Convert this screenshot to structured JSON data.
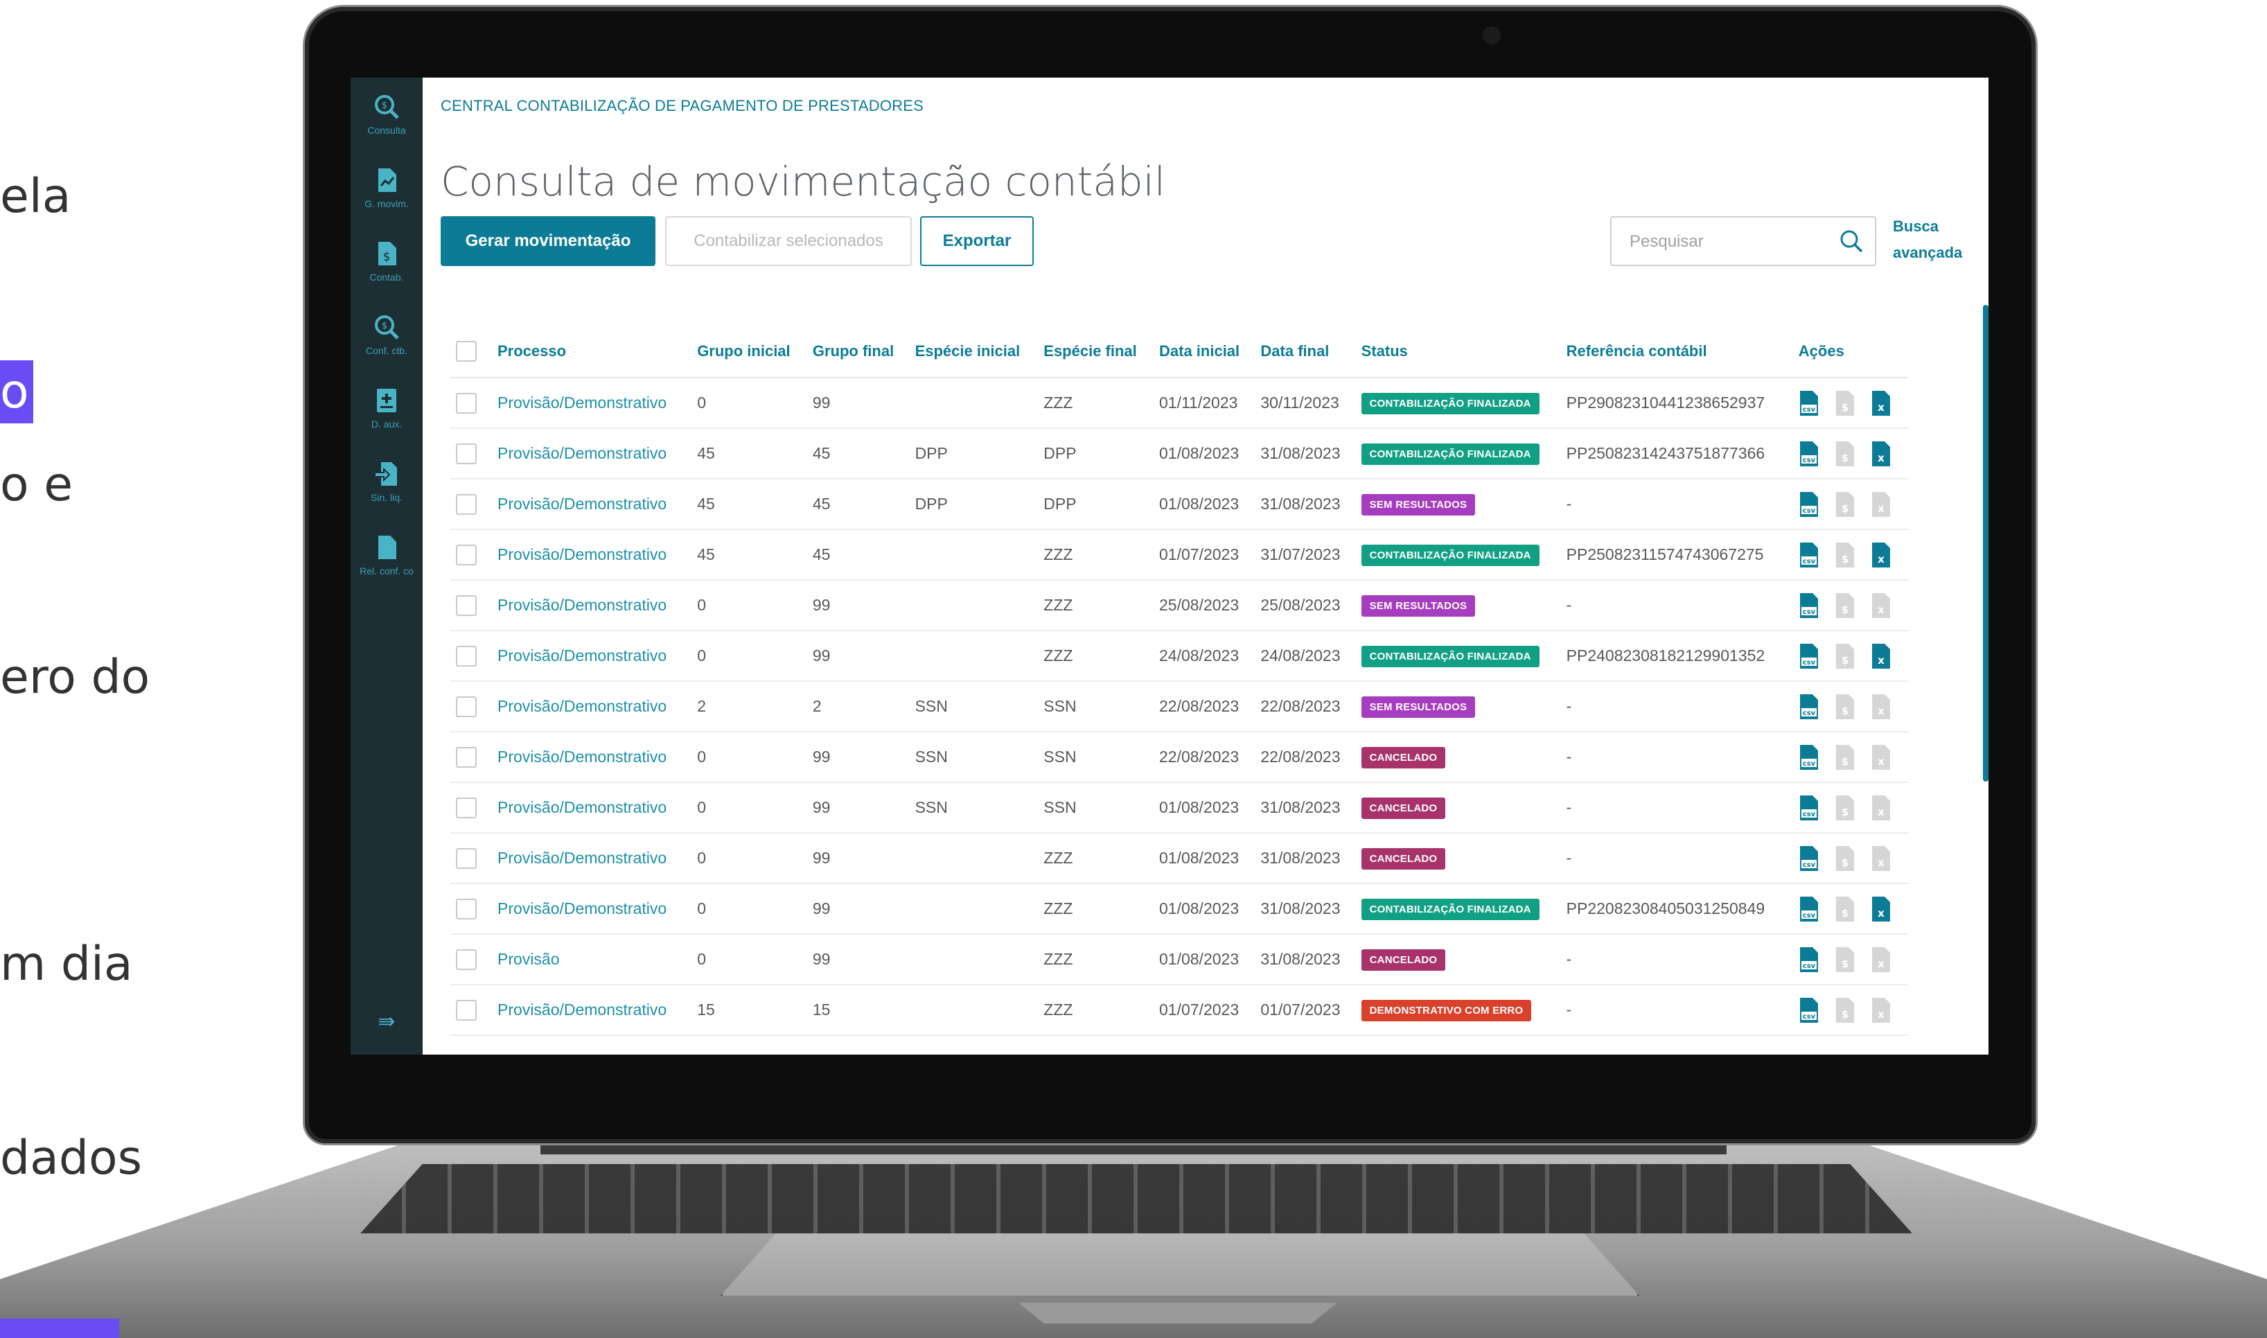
{
  "slide_fragments": [
    {
      "text": "ela"
    },
    {
      "text": "o",
      "highlight": true
    },
    {
      "text": "o e"
    },
    {
      "text": "ero do"
    },
    {
      "text": "m dia"
    },
    {
      "text": "dados"
    }
  ],
  "sidebar": {
    "items": [
      {
        "label": "Consulta",
        "icon": "search-money-icon"
      },
      {
        "label": "G. movim.",
        "icon": "file-chart-icon"
      },
      {
        "label": "Contab.",
        "icon": "file-money-icon"
      },
      {
        "label": "Conf. ctb.",
        "icon": "search-money-icon"
      },
      {
        "label": "D. aux.",
        "icon": "plus-box-icon"
      },
      {
        "label": "Sin. liq.",
        "icon": "file-import-icon"
      },
      {
        "label": "Rel. conf. co",
        "icon": "file-icon"
      }
    ],
    "collapse_icon": "⇛"
  },
  "header": {
    "breadcrumb": "CENTRAL CONTABILIZAÇÃO DE PAGAMENTO DE PRESTADORES",
    "title": "Consulta de movimentação contábil"
  },
  "toolbar": {
    "generate_label": "Gerar movimentação",
    "post_selected_label": "Contabilizar selecionados",
    "export_label": "Exportar",
    "search_placeholder": "Pesquisar",
    "advanced_search_label": "Busca avançada"
  },
  "table": {
    "columns": [
      "Processo",
      "Grupo inicial",
      "Grupo final",
      "Espécie inicial",
      "Espécie final",
      "Data inicial",
      "Data final",
      "Status",
      "Referência contábil",
      "Ações"
    ],
    "rows": [
      {
        "processo": "Provisão/Demonstrativo",
        "grupo_inicial": "0",
        "grupo_final": "99",
        "especie_inicial": "",
        "especie_final": "ZZZ",
        "data_inicial": "01/11/2023",
        "data_final": "30/11/2023",
        "status": "CONTABILIZAÇÃO FINALIZADA",
        "referencia": "PP29082310441238652937"
      },
      {
        "processo": "Provisão/Demonstrativo",
        "grupo_inicial": "45",
        "grupo_final": "45",
        "especie_inicial": "DPP",
        "especie_final": "DPP",
        "data_inicial": "01/08/2023",
        "data_final": "31/08/2023",
        "status": "CONTABILIZAÇÃO FINALIZADA",
        "referencia": "PP25082314243751877366"
      },
      {
        "processo": "Provisão/Demonstrativo",
        "grupo_inicial": "45",
        "grupo_final": "45",
        "especie_inicial": "DPP",
        "especie_final": "DPP",
        "data_inicial": "01/08/2023",
        "data_final": "31/08/2023",
        "status": "SEM RESULTADOS",
        "referencia": "-"
      },
      {
        "processo": "Provisão/Demonstrativo",
        "grupo_inicial": "45",
        "grupo_final": "45",
        "especie_inicial": "",
        "especie_final": "ZZZ",
        "data_inicial": "01/07/2023",
        "data_final": "31/07/2023",
        "status": "CONTABILIZAÇÃO FINALIZADA",
        "referencia": "PP25082311574743067275"
      },
      {
        "processo": "Provisão/Demonstrativo",
        "grupo_inicial": "0",
        "grupo_final": "99",
        "especie_inicial": "",
        "especie_final": "ZZZ",
        "data_inicial": "25/08/2023",
        "data_final": "25/08/2023",
        "status": "SEM RESULTADOS",
        "referencia": "-"
      },
      {
        "processo": "Provisão/Demonstrativo",
        "grupo_inicial": "0",
        "grupo_final": "99",
        "especie_inicial": "",
        "especie_final": "ZZZ",
        "data_inicial": "24/08/2023",
        "data_final": "24/08/2023",
        "status": "CONTABILIZAÇÃO FINALIZADA",
        "referencia": "PP24082308182129901352"
      },
      {
        "processo": "Provisão/Demonstrativo",
        "grupo_inicial": "2",
        "grupo_final": "2",
        "especie_inicial": "SSN",
        "especie_final": "SSN",
        "data_inicial": "22/08/2023",
        "data_final": "22/08/2023",
        "status": "SEM RESULTADOS",
        "referencia": "-"
      },
      {
        "processo": "Provisão/Demonstrativo",
        "grupo_inicial": "0",
        "grupo_final": "99",
        "especie_inicial": "SSN",
        "especie_final": "SSN",
        "data_inicial": "22/08/2023",
        "data_final": "22/08/2023",
        "status": "CANCELADO",
        "referencia": "-"
      },
      {
        "processo": "Provisão/Demonstrativo",
        "grupo_inicial": "0",
        "grupo_final": "99",
        "especie_inicial": "SSN",
        "especie_final": "SSN",
        "data_inicial": "01/08/2023",
        "data_final": "31/08/2023",
        "status": "CANCELADO",
        "referencia": "-"
      },
      {
        "processo": "Provisão/Demonstrativo",
        "grupo_inicial": "0",
        "grupo_final": "99",
        "especie_inicial": "",
        "especie_final": "ZZZ",
        "data_inicial": "01/08/2023",
        "data_final": "31/08/2023",
        "status": "CANCELADO",
        "referencia": "-"
      },
      {
        "processo": "Provisão/Demonstrativo",
        "grupo_inicial": "0",
        "grupo_final": "99",
        "especie_inicial": "",
        "especie_final": "ZZZ",
        "data_inicial": "01/08/2023",
        "data_final": "31/08/2023",
        "status": "CONTABILIZAÇÃO FINALIZADA",
        "referencia": "PP22082308405031250849"
      },
      {
        "processo": "Provisão",
        "grupo_inicial": "0",
        "grupo_final": "99",
        "especie_inicial": "",
        "especie_final": "ZZZ",
        "data_inicial": "01/08/2023",
        "data_final": "31/08/2023",
        "status": "CANCELADO",
        "referencia": "-"
      },
      {
        "processo": "Provisão/Demonstrativo",
        "grupo_inicial": "15",
        "grupo_final": "15",
        "especie_inicial": "",
        "especie_final": "ZZZ",
        "data_inicial": "01/07/2023",
        "data_final": "01/07/2023",
        "status": "DEMONSTRATIVO COM ERRO",
        "referencia": "-"
      }
    ]
  },
  "status_colors": {
    "CONTABILIZAÇÃO FINALIZADA": "#12a085",
    "SEM RESULTADOS": "#a63cbf",
    "CANCELADO": "#a8326a",
    "DEMONSTRATIVO COM ERRO": "#d9412b"
  },
  "colors": {
    "accent": "#0c7c96",
    "sidebar_bg": "#1c2f35",
    "highlight": "#6a4cf5",
    "action_active": "#0c7c96",
    "action_disabled": "#d6d6d6"
  }
}
